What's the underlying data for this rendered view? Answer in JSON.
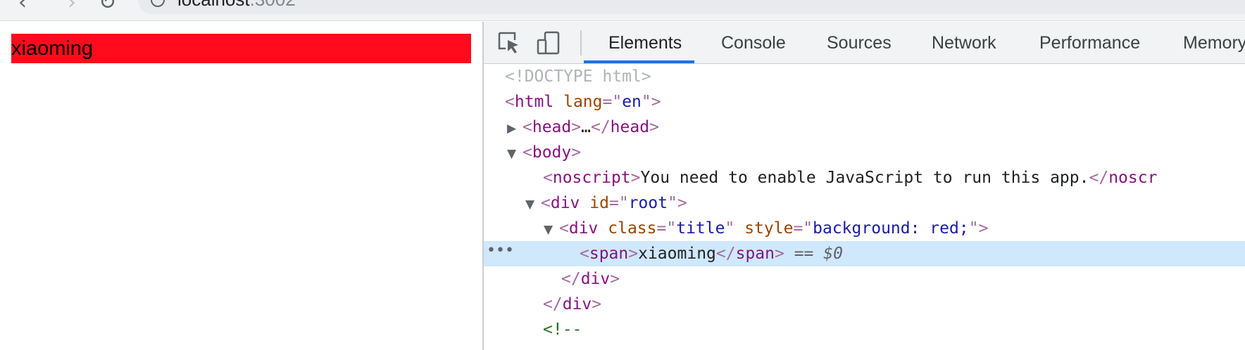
{
  "browser": {
    "address": {
      "host": "localhost",
      "port": ":3002"
    }
  },
  "page": {
    "title_text": "xiaoming",
    "title_bg": "#ff0b1c"
  },
  "devtools": {
    "tabs": [
      {
        "label": "Elements",
        "active": true
      },
      {
        "label": "Console",
        "active": false
      },
      {
        "label": "Sources",
        "active": false
      },
      {
        "label": "Network",
        "active": false
      },
      {
        "label": "Performance",
        "active": false
      },
      {
        "label": "Memory",
        "active": false
      }
    ],
    "icons": {
      "inspect": "inspect-element-icon",
      "device": "device-toolbar-icon"
    },
    "accent": "#1a73e8",
    "dom": {
      "doctype": "<!DOCTYPE html>",
      "html_tag": "html",
      "html_attr": "lang",
      "html_attr_val": "en",
      "head_tag": "head",
      "head_ellipsis": "…",
      "body_tag": "body",
      "noscript_tag": "noscript",
      "noscript_text": "You need to enable JavaScript to run this app.",
      "noscript_close": "noscr",
      "div_tag": "div",
      "root_attr": "id",
      "root_val": "root",
      "title_class_attr": "class",
      "title_class_val": "title",
      "title_style_attr": "style",
      "title_style_val": "background: red;",
      "span_tag": "span",
      "span_text": "xiaoming",
      "selected_marker": "==",
      "selected_var": "$0",
      "comment_start": "<!--",
      "row_menu": "•••"
    }
  }
}
